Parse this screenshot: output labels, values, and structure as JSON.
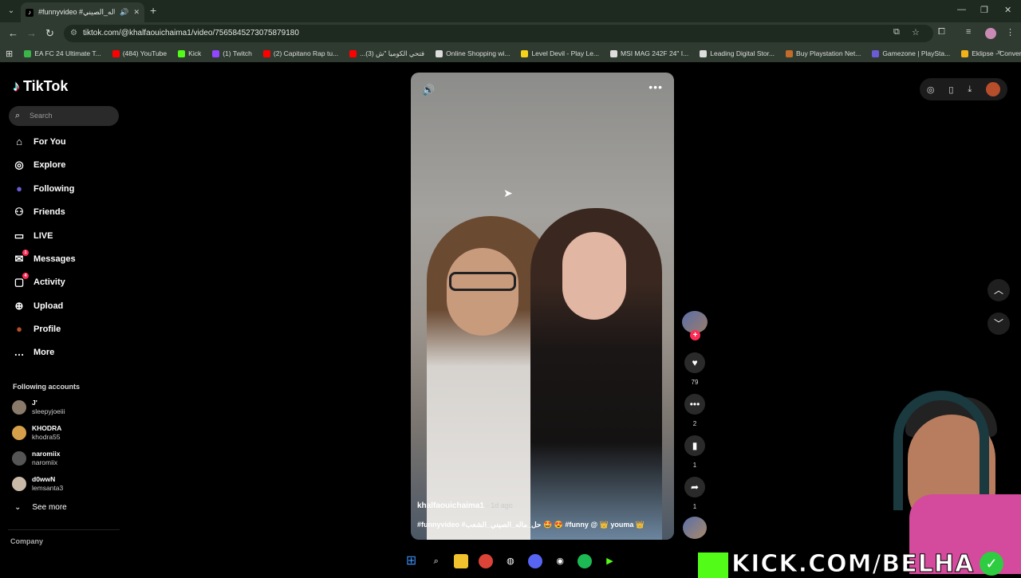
{
  "browser": {
    "tab_title": "#funnyvideo #حل_ماله_الصيني...",
    "url": "tiktok.com/@khalfaouichaima1/video/7565845273075879180",
    "bookmarks": [
      {
        "label": "EA FC 24 Ultimate T...",
        "color": "#3ab54a"
      },
      {
        "label": "(484) YouTube",
        "color": "#ff0000"
      },
      {
        "label": "Kick",
        "color": "#53fc18"
      },
      {
        "label": "(1) Twitch",
        "color": "#9146ff"
      },
      {
        "label": "(2) Capitano Rap tu...",
        "color": "#ff0000"
      },
      {
        "label": "...فتحي الكوميا \"ش (3)",
        "color": "#ff0000"
      },
      {
        "label": "Online Shopping wi...",
        "color": "#dddddd"
      },
      {
        "label": "Level Devil - Play Le...",
        "color": "#f6d21b"
      },
      {
        "label": "MSI MAG 242F 24\" I...",
        "color": "#dddddd"
      },
      {
        "label": "Leading Digital Stor...",
        "color": "#dddddd"
      },
      {
        "label": "Buy Playstation Net...",
        "color": "#c26b2a"
      },
      {
        "label": "Gamezone | PlaySta...",
        "color": "#6b5bd6"
      },
      {
        "label": "Eklipse - Convert Tw...",
        "color": "#f2b21b"
      }
    ]
  },
  "sidebar": {
    "logo": "TikTok",
    "search_placeholder": "Search",
    "nav": [
      {
        "label": "For You",
        "icon": "home-icon"
      },
      {
        "label": "Explore",
        "icon": "compass-icon"
      },
      {
        "label": "Following",
        "icon": "following-avatar-icon"
      },
      {
        "label": "Friends",
        "icon": "friends-icon"
      },
      {
        "label": "LIVE",
        "icon": "live-icon"
      },
      {
        "label": "Messages",
        "icon": "messages-icon",
        "badge": "1"
      },
      {
        "label": "Activity",
        "icon": "activity-icon",
        "badge": "4"
      },
      {
        "label": "Upload",
        "icon": "upload-icon"
      },
      {
        "label": "Profile",
        "icon": "profile-avatar-icon"
      },
      {
        "label": "More",
        "icon": "more-icon"
      }
    ],
    "following_title": "Following accounts",
    "accounts": [
      {
        "name": "J'",
        "handle": "sleepyjoeiii",
        "color": "#8a7a6a"
      },
      {
        "name": "KHODRA",
        "handle": "khodra55",
        "color": "#d6a04a"
      },
      {
        "name": "naromiix",
        "handle": "naromiix",
        "color": "#555555"
      },
      {
        "name": "d0wwN",
        "handle": "lemsanta3",
        "color": "#c9b9a9"
      }
    ],
    "see_more": "See more",
    "company": "Company"
  },
  "video": {
    "username": "khalfaouichaima1",
    "ago": "· 1d ago",
    "caption": "#funnyvideo #حل_ماله_الصيني_الشعب 🤩 😍 #funny @ 👑 youma 👑"
  },
  "actions": {
    "likes": "79",
    "comments": "2",
    "saves": "1",
    "shares": "1"
  },
  "overlay": {
    "kick_text": "KICK.COM/BELHA"
  },
  "colors": {
    "accent": "#fe2c55",
    "kick_green": "#53fc18"
  }
}
